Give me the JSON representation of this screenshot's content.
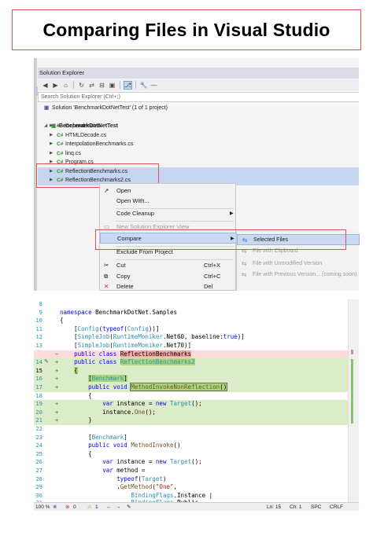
{
  "title": "Comparing Files in Visual Studio",
  "solution_explorer": {
    "panel_title": "Solution Explorer",
    "search_placeholder": "Search Solution Explorer (Ctrl+;)",
    "tree": [
      {
        "label": "Solution 'BenchmarkDotNetTest' (1 of 1 project)",
        "icon": "solution-icon"
      },
      {
        "label": "BenchmarkDotNetTest",
        "icon": "csharp-project-icon"
      },
      {
        "label": "Dependencies",
        "icon": "dependencies-icon"
      },
      {
        "label": "HTMLDecode.cs",
        "icon": "csharp-file-icon"
      },
      {
        "label": "InterpolationBenchmarks.cs",
        "icon": "csharp-file-icon"
      },
      {
        "label": "linq.cs",
        "icon": "csharp-file-icon"
      },
      {
        "label": "Program.cs",
        "icon": "csharp-file-icon"
      },
      {
        "label": "ReflectionBenchmarks.cs",
        "icon": "csharp-file-icon"
      },
      {
        "label": "ReflectionBenchmarks2.cs",
        "icon": "csharp-file-icon"
      }
    ],
    "context_menu": [
      {
        "label": "Open",
        "shortcut": "",
        "icon": "open-icon"
      },
      {
        "label": "Open With...",
        "shortcut": "",
        "icon": ""
      },
      {
        "label": "Code Cleanup",
        "shortcut": "",
        "icon": ""
      },
      {
        "label": "New Solution Explorer View",
        "shortcut": "",
        "icon": "new-view-icon"
      },
      {
        "label": "Compare",
        "shortcut": "",
        "icon": ""
      },
      {
        "label": "Exclude From Project",
        "shortcut": "",
        "icon": ""
      },
      {
        "label": "Cut",
        "shortcut": "Ctrl+X",
        "icon": "scissors-icon"
      },
      {
        "label": "Copy",
        "shortcut": "Ctrl+C",
        "icon": "copy-icon"
      },
      {
        "label": "Delete",
        "shortcut": "Del",
        "icon": "delete-icon"
      }
    ],
    "compare_submenu": [
      {
        "label": "Selected Files",
        "icon": "compare-icon"
      },
      {
        "label": "File with Clipboard",
        "icon": "compare-icon"
      },
      {
        "label": "File with Unmodified Version",
        "icon": "compare-icon"
      },
      {
        "label": "File with Previous Version... (coming soon)",
        "icon": "compare-icon"
      }
    ]
  },
  "editor": {
    "line_numbers": [
      "8",
      "9",
      "10",
      "11",
      "12",
      "13",
      "",
      "14",
      "15",
      "16",
      "17",
      "18",
      "19",
      "20",
      "21",
      "22",
      "23",
      "24",
      "25",
      "26",
      "27",
      "28",
      "29",
      "30",
      "31"
    ],
    "status": {
      "zoom": "100 %",
      "errors": "0",
      "warnings": "1",
      "line": "Ln: 15",
      "col": "Ch: 1",
      "spacing": "SPC",
      "line_ending": "CRLF"
    }
  },
  "colors": {
    "accent_red": "#d9534f",
    "diff_removed": "#fcdcdc",
    "diff_added": "#dcecc8",
    "selection": "#c6d5f0"
  }
}
